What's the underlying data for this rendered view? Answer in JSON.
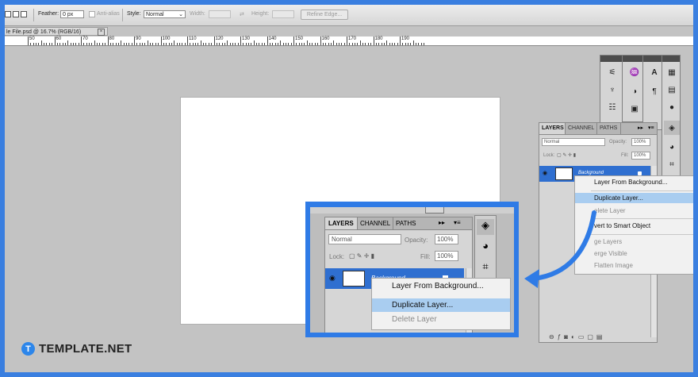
{
  "options_bar": {
    "feather_label": "Feather:",
    "feather_value": "0 px",
    "antialias_label": "Anti-alias",
    "style_label": "Style:",
    "style_value": "Normal",
    "width_label": "Width:",
    "height_label": "Height:",
    "refine_edge": "Refine Edge..."
  },
  "document_tab": {
    "title": "le File.psd @ 16.7% (RGB/16)",
    "close": "×"
  },
  "ruler": [
    "50",
    "60",
    "70",
    "80",
    "90",
    "100",
    "110",
    "120",
    "130",
    "140",
    "150",
    "160",
    "170",
    "180",
    "190"
  ],
  "layers_panel": {
    "tabs": [
      "LAYERS",
      "CHANNEL",
      "PATHS"
    ],
    "blend_mode": "Normal",
    "opacity_label": "Opacity:",
    "opacity_value": "100%",
    "lock_label": "Lock:",
    "fill_label": "Fill:",
    "fill_value": "100%",
    "layer_name": "Background",
    "menu_btn": "▾≡",
    "collapse_btn": "▸▸"
  },
  "context_menu": {
    "items": [
      {
        "label": "Layer From Background...",
        "state": "normal"
      },
      {
        "label": "Duplicate Layer...",
        "state": "highlighted"
      },
      {
        "label": "Delete Layer",
        "state": "disabled"
      },
      {
        "label": "Convert to Smart Object",
        "state": "normal"
      },
      {
        "label": "Merge Layers",
        "state": "disabled"
      },
      {
        "label": "Merge Visible",
        "state": "disabled"
      },
      {
        "label": "Flatten Image",
        "state": "disabled"
      }
    ],
    "visible_texts": [
      "Layer From Background...",
      "Duplicate Layer...",
      "elete Layer",
      "vert to Smart Object",
      "ge Layers",
      "erge Visible",
      "Flatten Image"
    ]
  },
  "zoom_callout": {
    "tabs": [
      "LAYERS",
      "CHANNEL",
      "PATHS"
    ],
    "blend_mode": "Normal",
    "opacity_label": "Opacity:",
    "opacity_value": "100%",
    "lock_label": "Lock:",
    "fill_label": "Fill:",
    "fill_value": "100%",
    "layer_name": "Background",
    "menu_items": [
      "Layer From Background...",
      "Duplicate Layer...",
      "Delete Layer"
    ]
  },
  "logo": {
    "badge": "T",
    "text": "TEMPLATE.NET"
  },
  "colors": {
    "frame": "#3a7fe0",
    "workspace": "#c3c3c3",
    "selection": "#2f6fd0",
    "menu_highlight": "#a9cdf0"
  }
}
